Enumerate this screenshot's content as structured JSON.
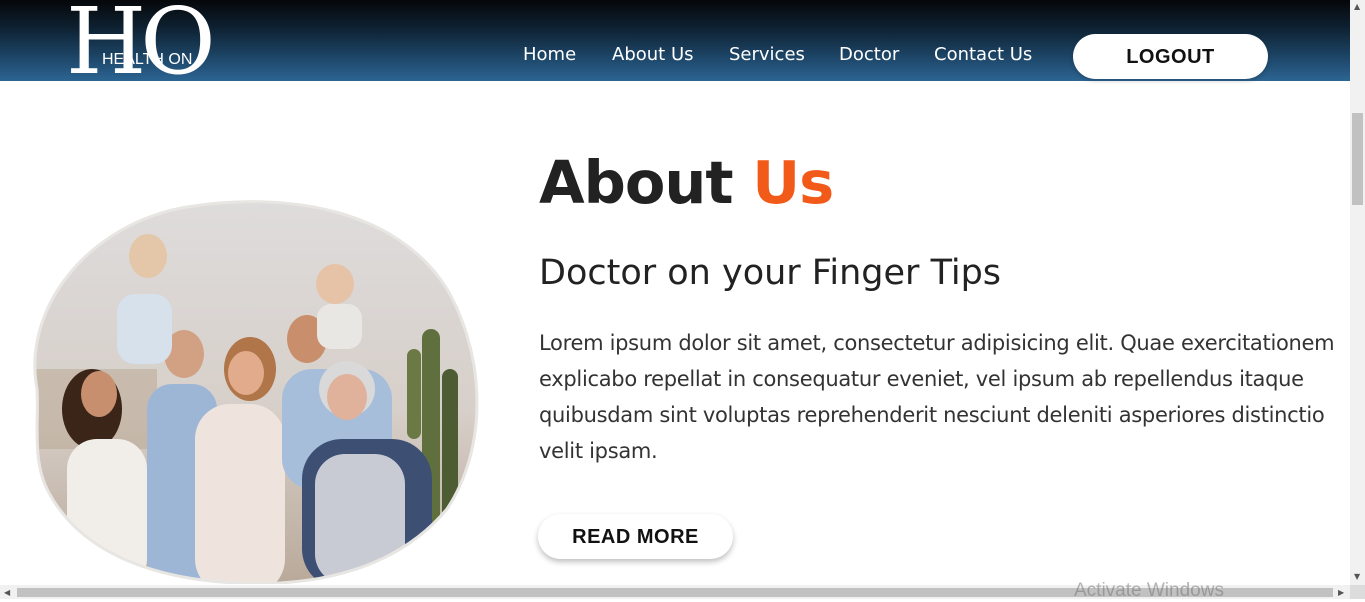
{
  "header": {
    "logo": {
      "big": "HO",
      "small": "HEALTH ON"
    },
    "nav": [
      "Home",
      "About Us",
      "Services",
      "Doctor",
      "Contact Us"
    ],
    "logout_label": "LOGOUT"
  },
  "about": {
    "title_main": "About",
    "title_accent": "Us",
    "subtitle": "Doctor on your Finger Tips",
    "paragraph": "Lorem ipsum dolor sit amet, consectetur adipisicing elit. Quae exercitationem explicabo repellat in consequatur eveniet, vel ipsum ab repellendus itaque quibusdam sint voluptas reprehenderit nesciunt deleniti asperiores distinctio velit ipsam.",
    "read_more_label": "READ MORE"
  },
  "colors": {
    "accent": "#f25a1a",
    "header_top": "#050709",
    "header_bottom": "#2c6593"
  },
  "watermark": "Activate Windows"
}
